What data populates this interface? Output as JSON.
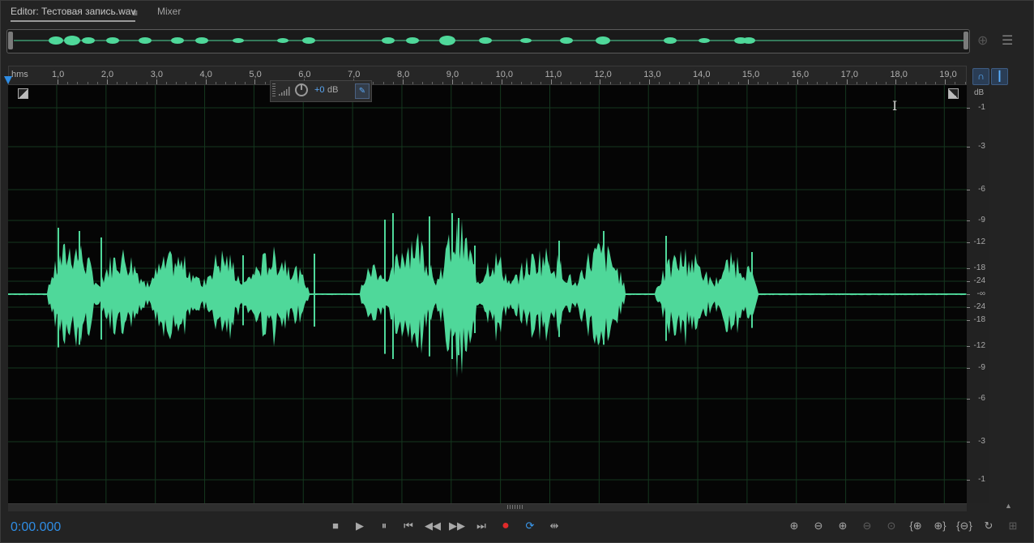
{
  "tabs": {
    "editor_label": "Editor: Тестовая запись.wav",
    "menu_glyph": "≡",
    "mixer_label": "Mixer"
  },
  "ruler": {
    "unit_label": "hms",
    "ticks": [
      "1,0",
      "2,0",
      "3,0",
      "4,0",
      "5,0",
      "6,0",
      "7,0",
      "8,0",
      "9,0",
      "10,0",
      "11,0",
      "12,0",
      "13,0",
      "14,0",
      "15,0",
      "16,0",
      "17,0",
      "18,0",
      "19,0"
    ]
  },
  "hud": {
    "volume_value": "+0",
    "volume_unit": "dB"
  },
  "db_scale": {
    "unit": "dB",
    "top_labels": [
      "-1",
      "-3",
      "-6",
      "-9",
      "-12",
      "-18",
      "-24",
      "-∞",
      "-24",
      "-18",
      "-12",
      "-9",
      "-6",
      "-3",
      "-1"
    ]
  },
  "transport": {
    "time": "0:00.000",
    "buttons": [
      "stop-icon",
      "play-icon",
      "pause-icon",
      "skip-back-icon",
      "rewind-icon",
      "fast-forward-icon",
      "skip-forward-icon",
      "record-icon",
      "loop-icon",
      "skip-selection-icon"
    ]
  },
  "zoom": {
    "buttons": [
      "zoom-in-amplitude-icon",
      "zoom-out-amplitude-icon",
      "zoom-in-time-icon",
      "zoom-out-time-icon",
      "zoom-selection-icon",
      "zoom-in-left-icon",
      "zoom-in-right-icon",
      "zoom-out-full-icon",
      "zoom-reset-icon",
      "zoom-fit-icon"
    ]
  },
  "colors": {
    "waveform": "#4fd89a",
    "accent": "#2f8de4",
    "record": "#e02a2a"
  }
}
